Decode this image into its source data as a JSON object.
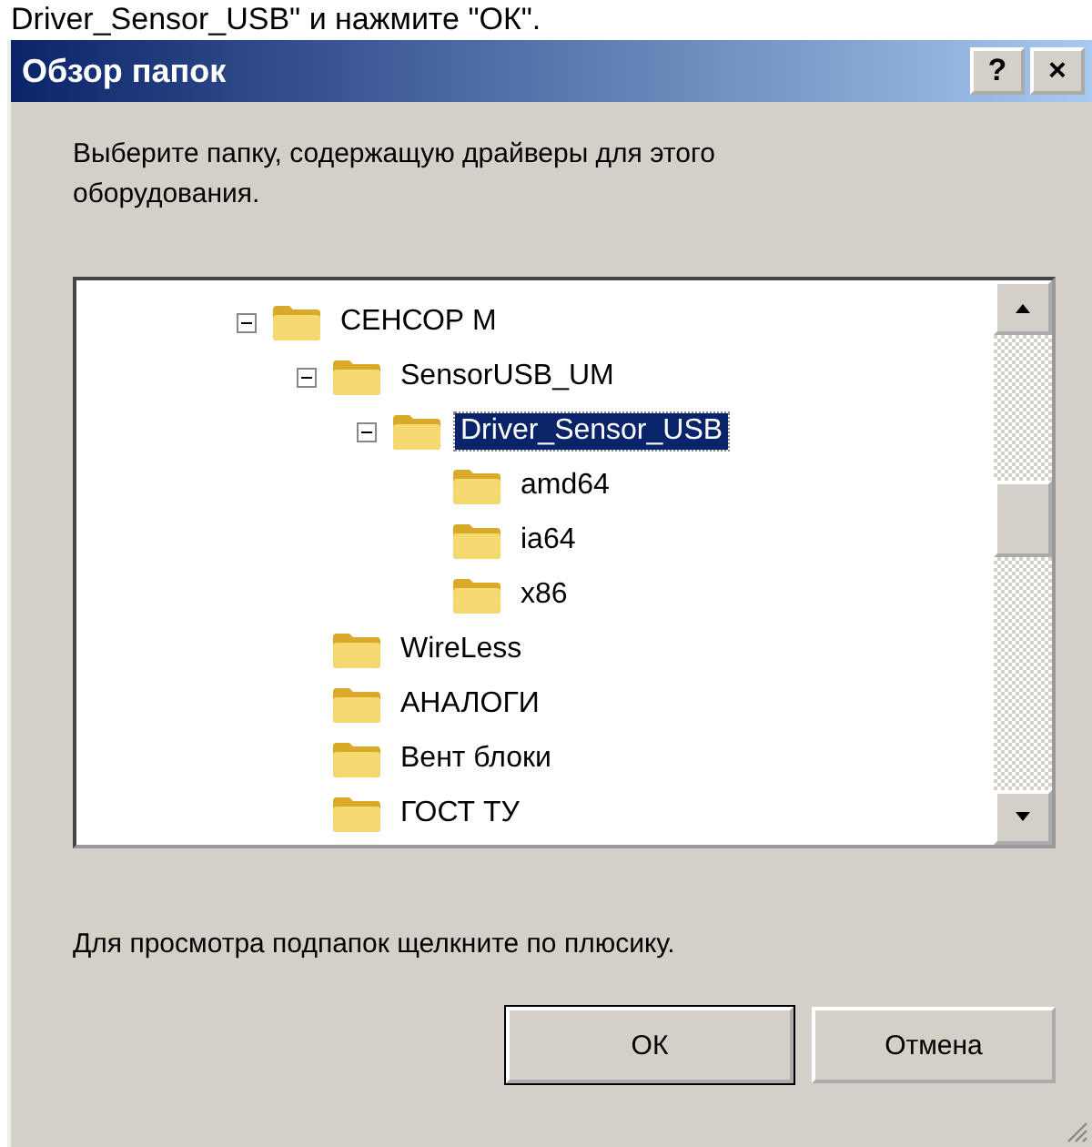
{
  "caption_above": "Driver_Sensor_USB\" и нажмите \"ОК\".",
  "window": {
    "title": "Обзор папок",
    "title_buttons": [
      "?",
      "×"
    ]
  },
  "prompt": "Выберите папку, содержащую драйверы для этого оборудования.",
  "tree": [
    {
      "label": "СЕНСОР М",
      "expanded": true,
      "selected": false,
      "children": [
        {
          "label": "SensorUSB_UM",
          "expanded": true,
          "selected": false,
          "children": [
            {
              "label": "Driver_Sensor_USB",
              "expanded": true,
              "selected": true,
              "children": [
                {
                  "label": "amd64",
                  "selected": false
                },
                {
                  "label": "ia64",
                  "selected": false
                },
                {
                  "label": "x86",
                  "selected": false
                }
              ]
            }
          ]
        },
        {
          "label": "WireLess",
          "selected": false
        },
        {
          "label": "АНАЛОГИ",
          "selected": false
        },
        {
          "label": "Вент блоки",
          "selected": false
        },
        {
          "label": "ГОСТ ТУ",
          "selected": false
        }
      ]
    }
  ],
  "hint": "Для просмотра подпапок щелкните по плюсику.",
  "buttons": [
    {
      "label": "ОК",
      "default": true
    },
    {
      "label": "Отмена",
      "default": false
    }
  ]
}
